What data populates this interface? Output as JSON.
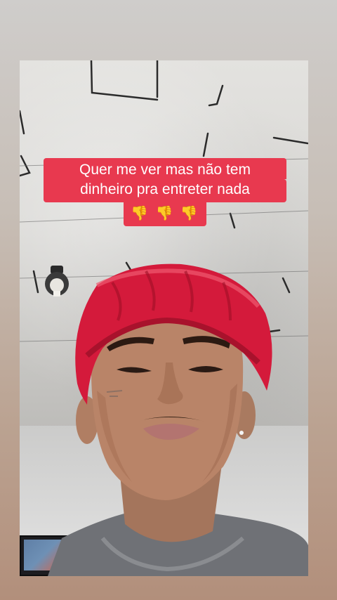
{
  "story": {
    "caption_line_1": "Quer me ver mas não tem",
    "caption_line_2": "dinheiro pra entreter nada",
    "caption_emoji": [
      {
        "icon": "thumbs-down-icon",
        "glyph": "👎"
      },
      {
        "icon": "thumbs-down-icon",
        "glyph": "👎"
      },
      {
        "icon": "thumbs-down-icon",
        "glyph": "👎"
      }
    ]
  },
  "colors": {
    "caption_background": "#e8394f",
    "caption_text": "#ffffff",
    "bonnet": "#d41a3b",
    "background_top": "#cfcdcb",
    "background_bottom": "#b28f7b"
  }
}
